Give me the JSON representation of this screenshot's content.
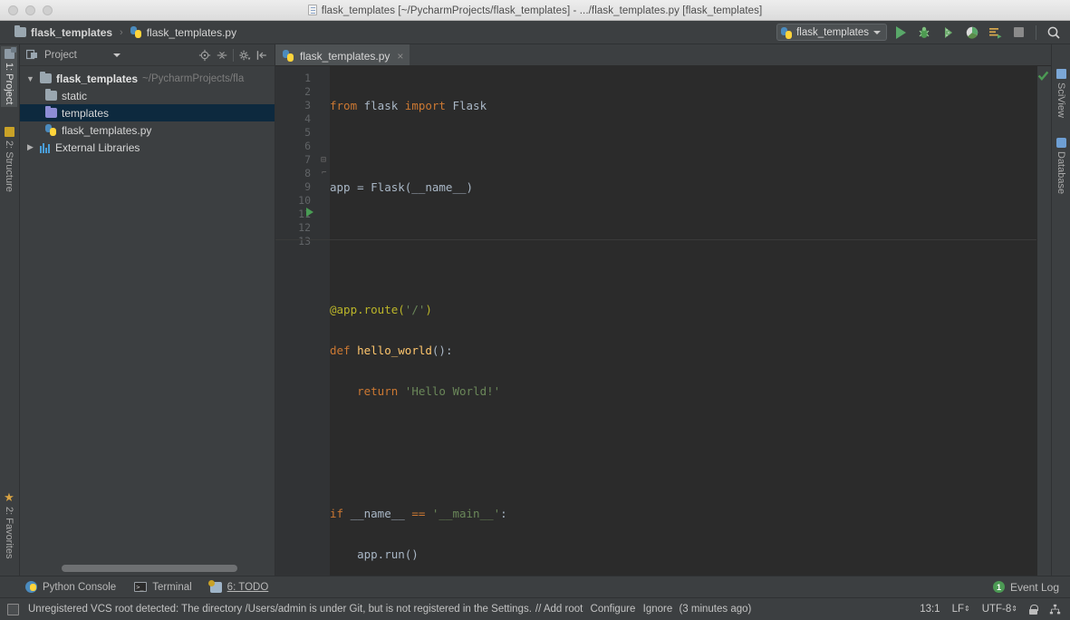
{
  "window": {
    "title": "flask_templates [~/PycharmProjects/flask_templates] - .../flask_templates.py [flask_templates]",
    "title_icon": "python-file-icon"
  },
  "navbar": {
    "breadcrumbs": [
      {
        "label": "flask_templates",
        "icon": "folder-icon"
      },
      {
        "label": "flask_templates.py",
        "icon": "python-file-icon"
      }
    ],
    "run_config": {
      "label": "flask_templates",
      "icon": "python-file-icon"
    },
    "buttons": [
      {
        "name": "run-button",
        "icon": "run-triangle-icon",
        "title": "Run"
      },
      {
        "name": "debug-button",
        "icon": "debug-bug-icon",
        "title": "Debug"
      },
      {
        "name": "run-coverage-button",
        "icon": "coverage-icon",
        "title": "Run with Coverage"
      },
      {
        "name": "profile-button",
        "icon": "profile-icon",
        "title": "Profile"
      },
      {
        "name": "attach-console-button",
        "icon": "attach-icon",
        "title": "Attach"
      },
      {
        "name": "stop-button",
        "icon": "stop-square-icon",
        "title": "Stop"
      },
      {
        "name": "search-everywhere-button",
        "icon": "search-icon",
        "title": "Search Everywhere"
      }
    ]
  },
  "left_stripe": {
    "tabs": [
      {
        "label": "1: Project",
        "icon": "project-icon",
        "active": true
      },
      {
        "label": "2: Structure",
        "icon": "structure-icon",
        "active": false
      },
      {
        "label": "2: Favorites",
        "icon": "star-icon",
        "active": false
      }
    ]
  },
  "right_stripe": {
    "tabs": [
      {
        "label": "SciView",
        "icon": "sciview-grid-icon"
      },
      {
        "label": "Database",
        "icon": "database-icon"
      }
    ]
  },
  "project_panel": {
    "title": "Project",
    "toolbar_icons": [
      {
        "name": "locate-target-icon"
      },
      {
        "name": "collapse-all-icon"
      },
      {
        "name": "settings-gear-icon"
      },
      {
        "name": "hide-panel-icon"
      }
    ],
    "tree": [
      {
        "label": "flask_templates",
        "path": "~/PycharmProjects/fla",
        "icon": "folder-icon",
        "arrow": "▼",
        "bold": true,
        "indent": 0,
        "selected": false
      },
      {
        "label": "static",
        "path": "",
        "icon": "folder-icon",
        "arrow": "",
        "bold": false,
        "indent": 2,
        "selected": false
      },
      {
        "label": "templates",
        "path": "",
        "icon": "folder-blue-icon",
        "arrow": "",
        "bold": false,
        "indent": 2,
        "selected": true
      },
      {
        "label": "flask_templates.py",
        "path": "",
        "icon": "python-file-icon",
        "arrow": "",
        "bold": false,
        "indent": 2,
        "selected": false
      },
      {
        "label": "External Libraries",
        "path": "",
        "icon": "library-icon",
        "arrow": "▶",
        "bold": false,
        "indent": 0,
        "selected": false
      }
    ]
  },
  "editor": {
    "tab": {
      "label": "flask_templates.py",
      "icon": "python-file-icon",
      "close": "×"
    },
    "inspection_status": "ok-check-icon",
    "line_numbers": [
      "1",
      "2",
      "3",
      "4",
      "5",
      "6",
      "7",
      "8",
      "9",
      "10",
      "11",
      "12",
      "13"
    ],
    "lines": [
      {
        "n": 1,
        "tokens": [
          {
            "t": "from",
            "c": "k"
          },
          {
            "t": " flask ",
            "c": "p"
          },
          {
            "t": "import",
            "c": "k"
          },
          {
            "t": " Flask",
            "c": "p"
          }
        ]
      },
      {
        "n": 2,
        "tokens": []
      },
      {
        "n": 3,
        "tokens": [
          {
            "t": "app = Flask(__name__)",
            "c": "p"
          }
        ]
      },
      {
        "n": 4,
        "tokens": []
      },
      {
        "n": 5,
        "tokens": []
      },
      {
        "n": 6,
        "tokens": [
          {
            "t": "@app.route(",
            "c": "dec"
          },
          {
            "t": "'/'",
            "c": "s"
          },
          {
            "t": ")",
            "c": "dec"
          }
        ]
      },
      {
        "n": 7,
        "tokens": [
          {
            "t": "def ",
            "c": "k"
          },
          {
            "t": "hello_world",
            "c": "fn"
          },
          {
            "t": "():",
            "c": "p"
          }
        ]
      },
      {
        "n": 8,
        "tokens": [
          {
            "t": "    ",
            "c": "p"
          },
          {
            "t": "return ",
            "c": "k"
          },
          {
            "t": "'Hello World!'",
            "c": "s"
          }
        ]
      },
      {
        "n": 9,
        "tokens": []
      },
      {
        "n": 10,
        "tokens": []
      },
      {
        "n": 11,
        "tokens": [
          {
            "t": "if ",
            "c": "k"
          },
          {
            "t": "__name__",
            "c": "p"
          },
          {
            "t": " == ",
            "c": "k"
          },
          {
            "t": "'__main__'",
            "c": "s"
          },
          {
            "t": ":",
            "c": "p"
          }
        ]
      },
      {
        "n": 12,
        "tokens": [
          {
            "t": "    app.run()",
            "c": "p"
          }
        ]
      },
      {
        "n": 13,
        "tokens": []
      }
    ],
    "gutter_run_marker_line": 11,
    "fold_marker_lines": [
      7,
      8
    ]
  },
  "bottom_bar": {
    "items": [
      {
        "label": "Python Console",
        "icon": "python-console-icon"
      },
      {
        "label": "Terminal",
        "icon": "terminal-icon"
      },
      {
        "label": "6: TODO",
        "icon": "todo-icon",
        "underline_prefix": "6"
      }
    ],
    "event_log": {
      "label": "Event Log",
      "badge": "1"
    }
  },
  "status_bar": {
    "message": "Unregistered VCS root detected: The directory /Users/admin is under Git, but is not registered in the Settings.",
    "links": [
      "// Add root",
      "Configure",
      "Ignore"
    ],
    "time_ago": "(3 minutes ago)",
    "caret_position": "13:1",
    "line_separator": "LF",
    "encoding": "UTF-8",
    "lock_icon": "lock-icon",
    "hierarchy_icon": "hierarchy-icon"
  },
  "colors": {
    "editor_bg": "#2B2B2B",
    "panel_bg": "#3C3F41",
    "gutter_bg": "#313335",
    "selection": "#0D293E",
    "keyword": "#CC7832",
    "string": "#6A8759",
    "decorator": "#BBB529",
    "function": "#FFC66D",
    "text": "#A9B7C6",
    "run_green": "#59A869"
  }
}
